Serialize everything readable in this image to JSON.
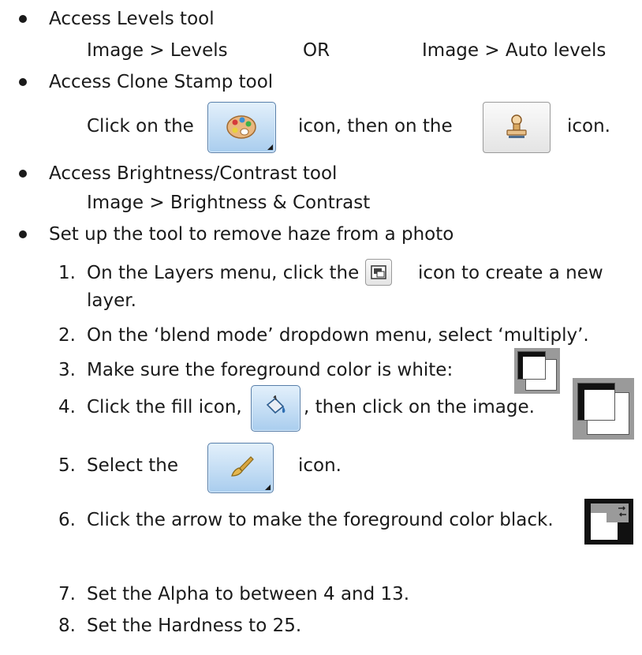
{
  "bullets": [
    {
      "text": "Access Levels tool"
    },
    {
      "text": "Access Clone Stamp tool"
    },
    {
      "text": "Access Brightness/Contrast tool"
    },
    {
      "text": "Set up the tool to remove haze from a photo"
    }
  ],
  "levels": {
    "option1": "Image > Levels",
    "or_label": "OR",
    "option2": "Image > Auto levels"
  },
  "clone": {
    "prefix": "Click on the",
    "middle": "icon, then on the",
    "suffix": "icon."
  },
  "brightness": {
    "path": "Image > Brightness & Contrast"
  },
  "steps": [
    {
      "num": "1.",
      "before": "On the Layers menu, click the",
      "after": "icon to create a new",
      "line2": "layer."
    },
    {
      "num": "2.",
      "text": "On the ‘blend mode’ dropdown menu, select ‘multiply’."
    },
    {
      "num": "3.",
      "text": "Make sure the foreground color is white:"
    },
    {
      "num": "4.",
      "before": "Click the fill icon,",
      "after": ", then click on the image."
    },
    {
      "num": "5.",
      "before": "Select the",
      "after": "icon."
    },
    {
      "num": "6.",
      "text": "Click the arrow to make the foreground color black."
    },
    {
      "num": "7.",
      "text": "Set the Alpha  to between 4 and 13."
    },
    {
      "num": "8.",
      "text": "Set the Hardness to 25."
    }
  ],
  "icons": {
    "paint_tools": "palette-icon",
    "clone_stamp": "clone-stamp-icon",
    "new_layer": "new-layer-icon",
    "fill": "bucket-fill-icon",
    "paintbrush": "paintbrush-icon",
    "fg_white_swatch": "foreground-white-swatch-icon",
    "swap_colors": "swap-colors-icon"
  },
  "colors": {
    "text": "#1a1a1a",
    "tool_button_blue": "#a9cdee",
    "swatch_gray": "#9a9a9a"
  }
}
